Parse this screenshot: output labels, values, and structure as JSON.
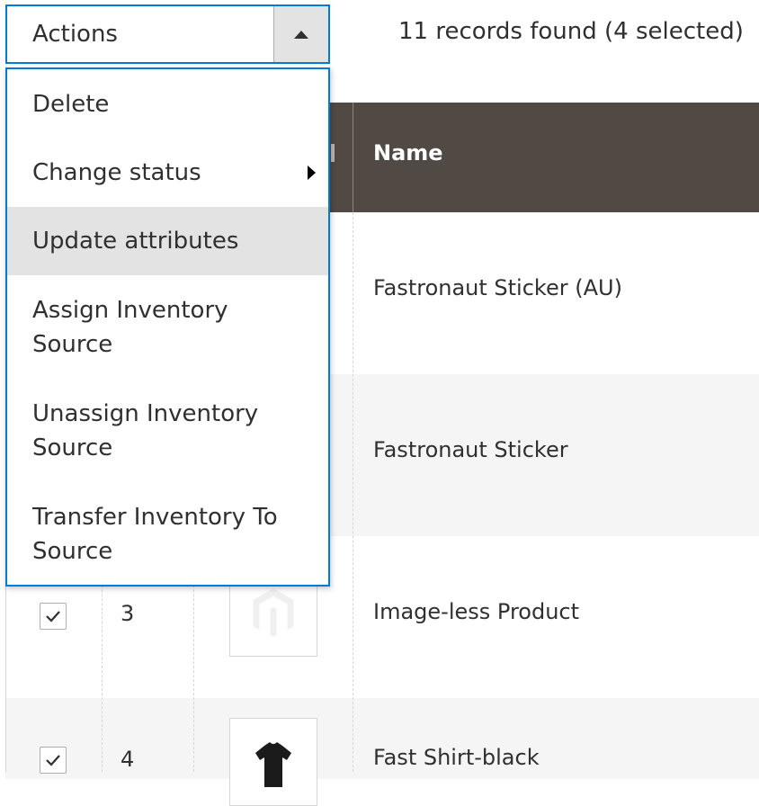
{
  "actions": {
    "label": "Actions",
    "records_text": "11 records found (4 selected)",
    "menu": [
      {
        "label": "Delete",
        "has_submenu": false
      },
      {
        "label": "Change status",
        "has_submenu": true
      },
      {
        "label": "Update attributes",
        "has_submenu": false,
        "hovered": true
      },
      {
        "label": "Assign Inventory Source",
        "has_submenu": false
      },
      {
        "label": "Unassign Inventory Source",
        "has_submenu": false
      },
      {
        "label": "Transfer Inventory To Source",
        "has_submenu": false
      }
    ]
  },
  "grid": {
    "columns": {
      "name": "Name"
    },
    "rows": [
      {
        "name": "Fastronaut Sticker (AU)"
      },
      {
        "name": "Fastronaut Sticker"
      },
      {
        "id": "3",
        "name": "Image-less Product",
        "checked": true,
        "thumbnail": "placeholder-logo"
      },
      {
        "id": "4",
        "name": "Fast Shirt-black",
        "checked": true,
        "thumbnail": "black-tshirt"
      }
    ]
  },
  "colors": {
    "header_bg": "#514943",
    "accent_border": "#007bdb",
    "row_alt_bg": "#f5f5f5",
    "hover_bg": "#e3e3e3"
  }
}
